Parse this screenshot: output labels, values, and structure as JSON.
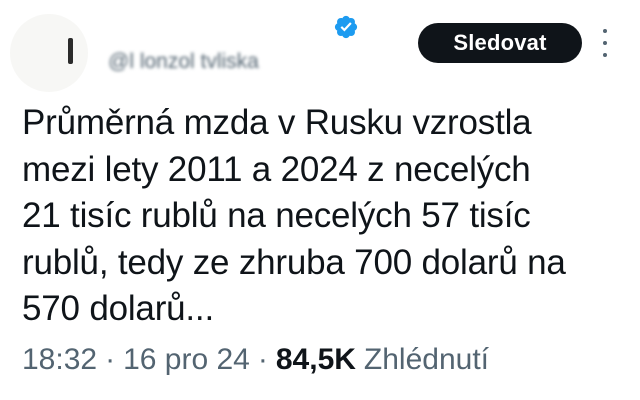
{
  "colors": {
    "text_primary": "#0f1419",
    "text_secondary": "#536471",
    "verified_badge": "#1d9bf0",
    "follow_button_bg": "#0f1419",
    "follow_button_text": "#ffffff"
  },
  "author": {
    "display_name": "",
    "handle": "@l lonzol tvliska",
    "verified_icon": "verified-badge-icon"
  },
  "follow_button": {
    "label": "Sledovat"
  },
  "more_menu": {
    "icon": "more-vertical-icon"
  },
  "tweet": {
    "text": "Průměrná mzda v Rusku vzrostla\nmezi lety 2011 a 2024 z necelých\n21 tisíc rublů na necelých 57 tisíc\nrublů, tedy ze zhruba 700 dolarů na\n570 dolarů..."
  },
  "meta": {
    "time": "18:32",
    "separator": "·",
    "date": "16 pro 24",
    "views_count": "84,5K",
    "views_label": "Zhlédnutí"
  }
}
